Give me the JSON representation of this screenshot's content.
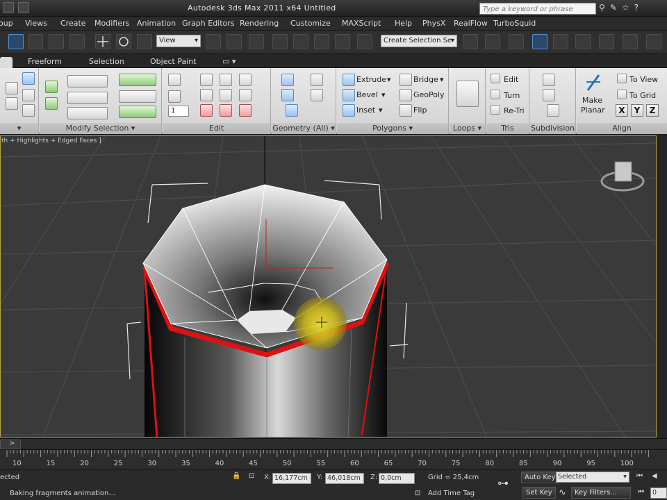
{
  "window": {
    "title": "Autodesk 3ds Max  2011 x64      Untitled",
    "search_placeholder": "Type a keyword or phrase"
  },
  "menu": [
    "oup",
    "Views",
    "Create",
    "Modifiers",
    "Animation",
    "Graph Editors",
    "Rendering",
    "Customize",
    "MAXScript",
    "Help",
    "PhysX",
    "RealFlow",
    "TurboSquid"
  ],
  "toolbar": {
    "ref_coord": "View",
    "selection_set": "Create Selection Se"
  },
  "ribbon_tabs": [
    "Freeform",
    "Selection",
    "Object Paint"
  ],
  "ribbon": {
    "modify_selection_label": "Modify Selection",
    "edit_label": "Edit",
    "edit_spinner": "1",
    "geometry_label": "Geometry (All)",
    "polygons_label": "Polygons",
    "polygons": {
      "extrude": "Extrude",
      "bevel": "Bevel",
      "inset": "Inset",
      "bridge": "Bridge",
      "geopoly": "GeoPoly",
      "flip": "Flip"
    },
    "loops_label": "Loops",
    "tris_label": "Tris",
    "tris": {
      "edit": "Edit",
      "turn": "Turn",
      "retri": "Re-Tri"
    },
    "subdivision_label": "Subdivision",
    "align_label": "Align",
    "align": {
      "make_planar_1": "Make",
      "make_planar_2": "Planar",
      "to_view": "To View",
      "to_grid": "To Grid",
      "x": "X",
      "y": "Y",
      "z": "Z"
    }
  },
  "viewport": {
    "label": "th + Highlights + Edged Faces ]"
  },
  "timeline": {
    "frame_arrow": ">",
    "ticks": [
      "10",
      "15",
      "20",
      "25",
      "30",
      "35",
      "40",
      "45",
      "50",
      "55",
      "60",
      "65",
      "70",
      "75",
      "80",
      "85",
      "90",
      "95",
      "100"
    ]
  },
  "status": {
    "selection_state": "ected",
    "prompt": "Baking fragments animation...",
    "x_label": "X:",
    "x_value": "16,177cm",
    "y_label": "Y:",
    "y_value": "46,018cm",
    "z_label": "Z:",
    "z_value": "0,0cm",
    "grid": "Grid = 25,4cm",
    "add_time_tag": "Add Time Tag",
    "auto_key": "Auto Key",
    "auto_key_value": "Selected",
    "set_key": "Set Key",
    "key_filters": "Key Filters...",
    "frame_field": "0"
  },
  "colors": {
    "ribbon_bg": "#dcdcdc",
    "viewport_bg": "#3a3a3a",
    "selection_red": "#e01010",
    "highlight_yellow": "#e8d020"
  }
}
